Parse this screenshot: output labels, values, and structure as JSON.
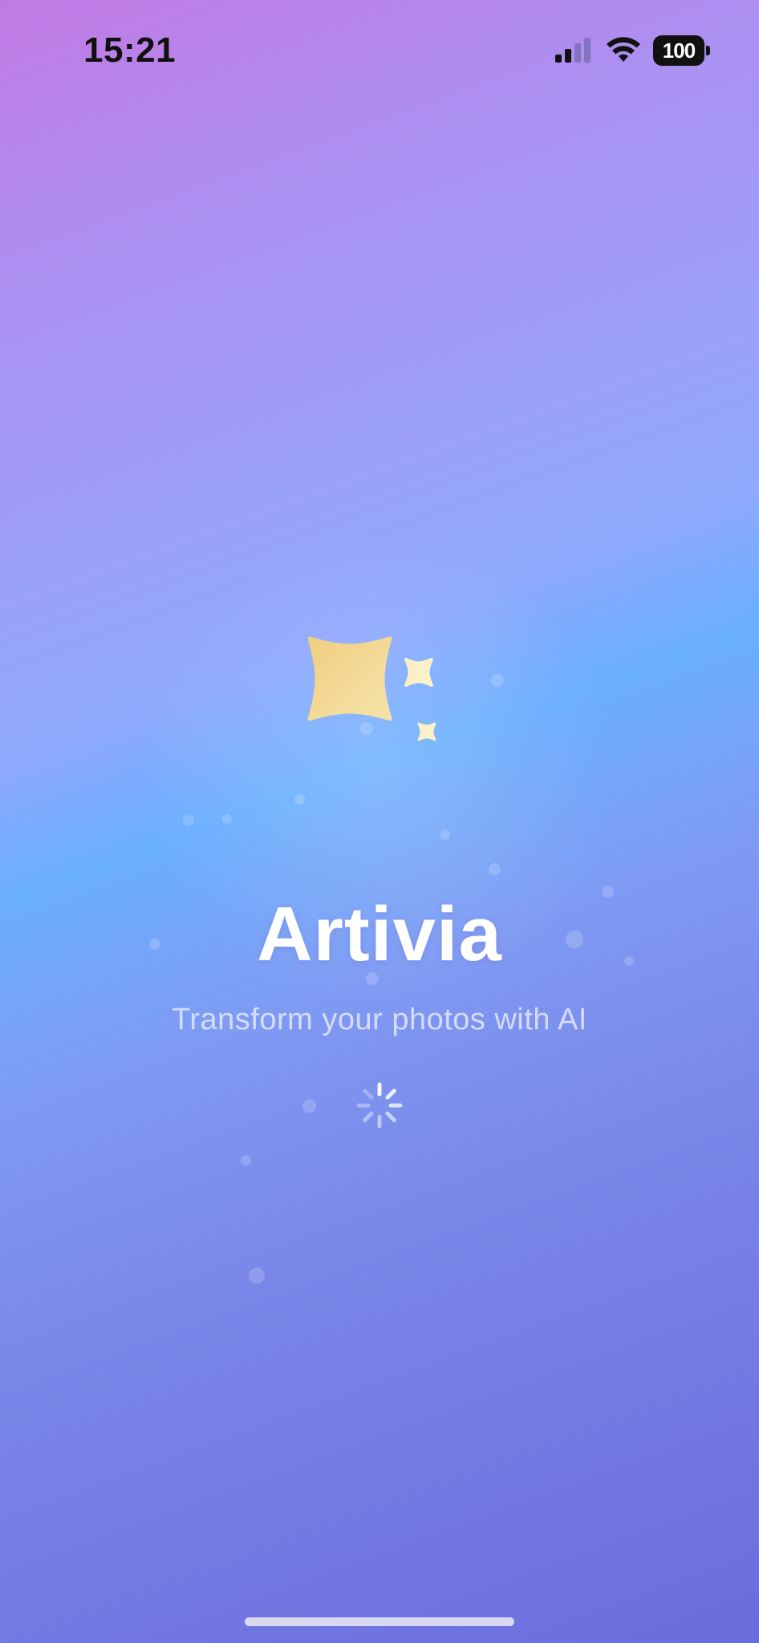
{
  "status_bar": {
    "time": "15:21",
    "battery": "100",
    "signal_icon": "cellular-signal-icon",
    "wifi_icon": "wifi-icon",
    "battery_icon": "battery-icon"
  },
  "splash": {
    "logo_icon": "sparkles-icon",
    "app_name": "Artivia",
    "tagline": "Transform your photos with AI",
    "loading_icon": "activity-spinner-icon"
  },
  "colors": {
    "gradient_top": "#c17ae4",
    "gradient_mid": "#6aaffe",
    "gradient_bottom": "#6b6cdc",
    "sparkle_gold": "#f2d48f",
    "sparkle_cream": "#fbf0c8"
  }
}
